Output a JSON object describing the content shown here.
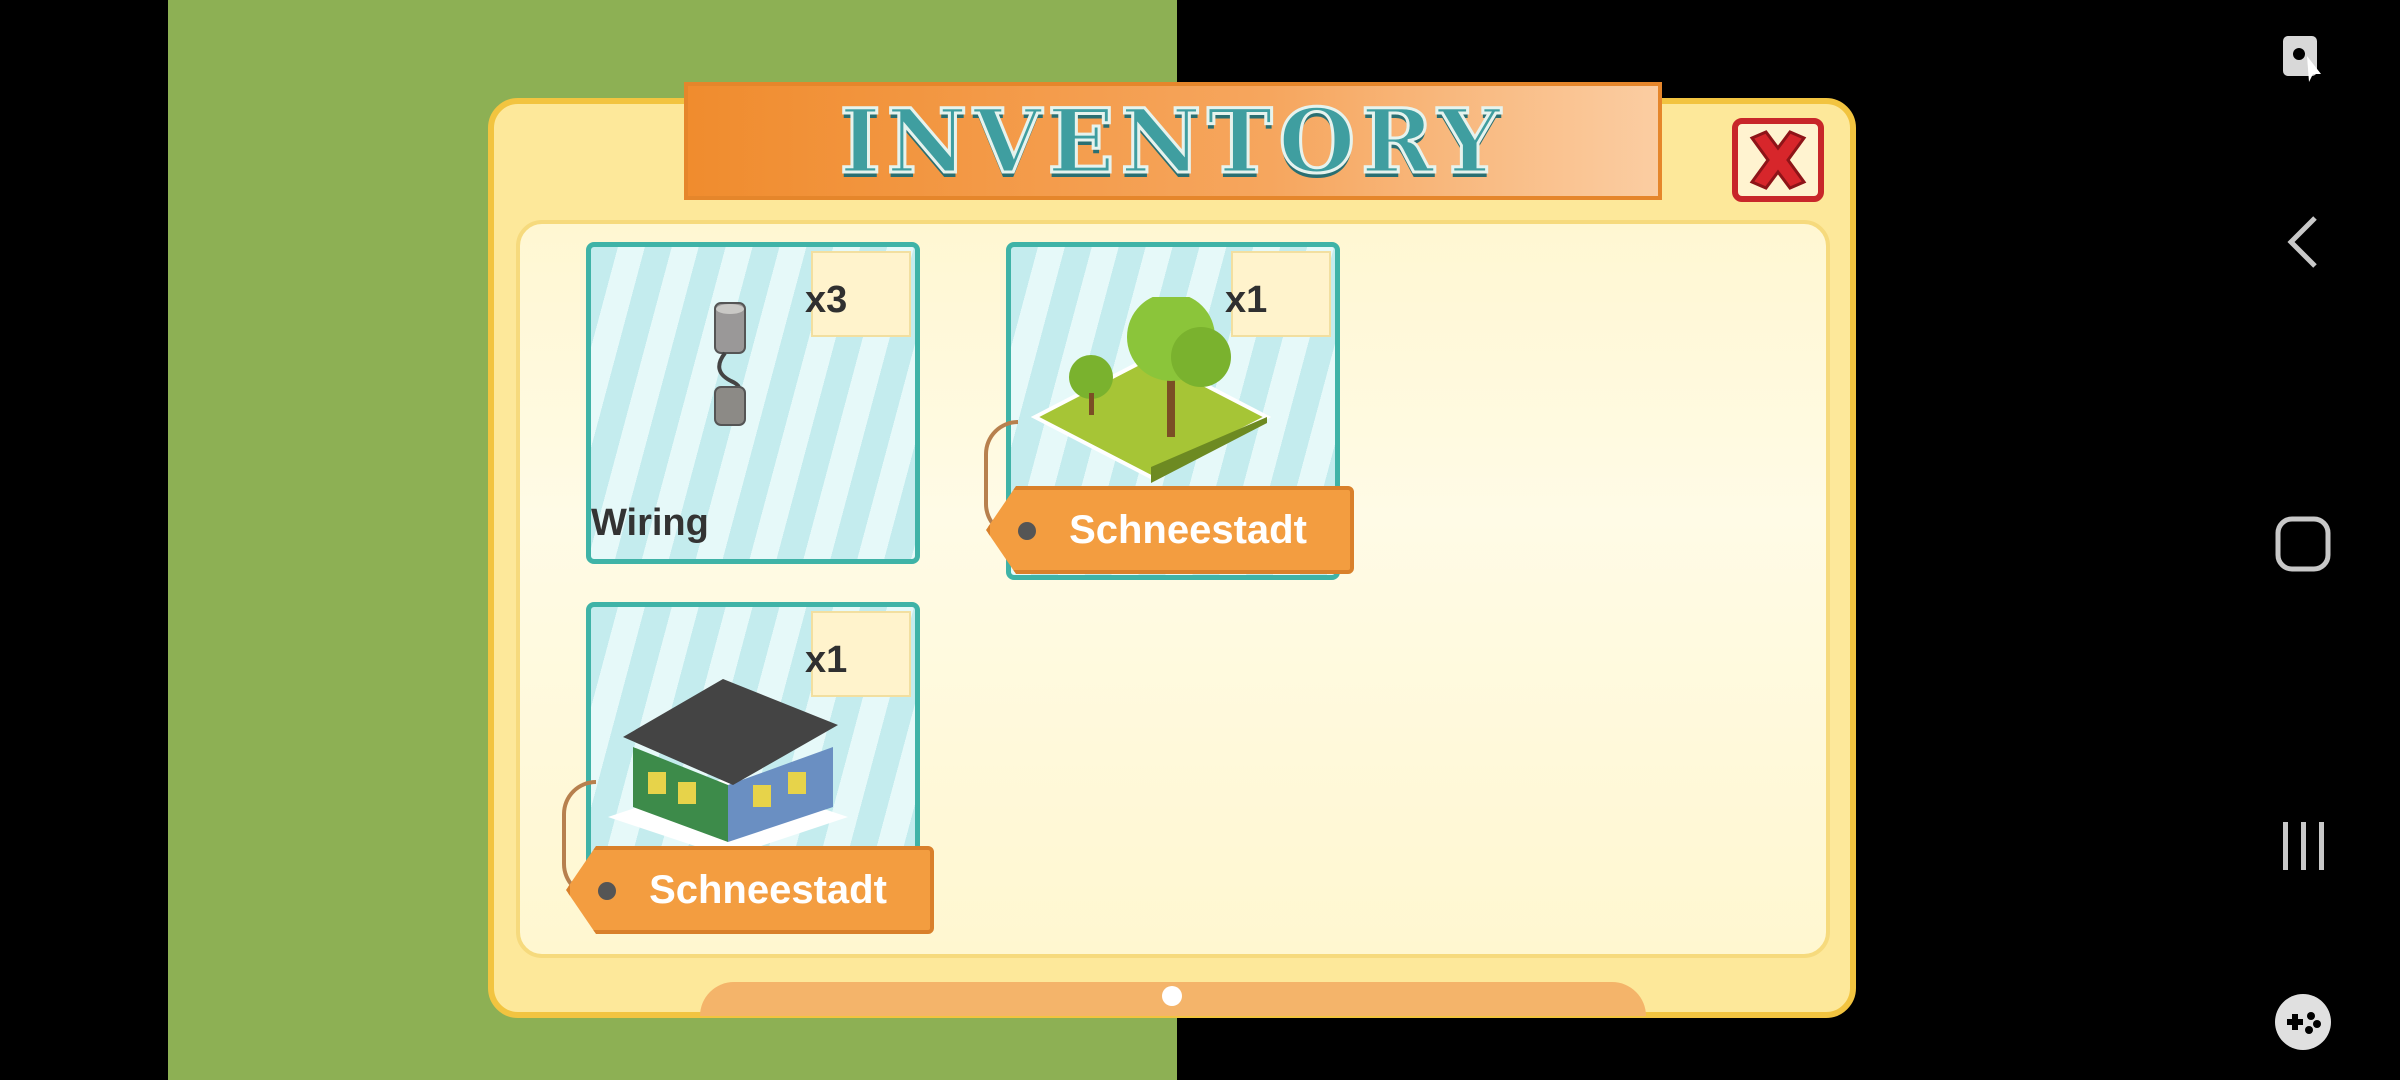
{
  "dialog": {
    "title": "INVENTORY",
    "close_label": "close"
  },
  "items": [
    {
      "name": "Wiring",
      "quantity": "x3",
      "icon": "wiring-icon",
      "tagged": false
    },
    {
      "name": "Schneestadt",
      "quantity": "x1",
      "icon": "tree-park-icon",
      "tagged": true
    },
    {
      "name": "Schneestadt",
      "quantity": "x1",
      "icon": "building-icon",
      "tagged": true
    }
  ],
  "pager": {
    "current_page": 1,
    "total_pages": 1
  },
  "nav": {
    "icons": [
      "screen-lock-icon",
      "back-icon",
      "home-icon",
      "recent-apps-icon",
      "game-tools-icon"
    ]
  },
  "colors": {
    "grass": "#8db054",
    "dialog_bg": "#fde89a",
    "card_border": "#3fb3a7",
    "tag_orange": "#f39d40",
    "close_red": "#c8262a",
    "title_teal": "#3f9ea0"
  }
}
